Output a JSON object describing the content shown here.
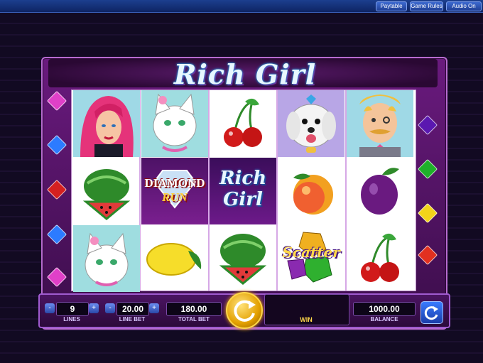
{
  "topbar": {
    "paytable": "Paytable",
    "game_rules": "Game Rules",
    "audio": "Audio On"
  },
  "logo": "Rich Girl",
  "reels": [
    [
      "woman",
      "watermelon",
      "white-cat"
    ],
    [
      "white-cat",
      "diamond-run",
      "lemon"
    ],
    [
      "cherries",
      "rich-girl",
      "watermelon"
    ],
    [
      "white-dog",
      "peach",
      "scatter-gems"
    ],
    [
      "butler",
      "plum",
      "cherries"
    ]
  ],
  "symbols": {
    "diamond_run_top": "DIAMOND",
    "diamond_run_bottom": "RUN",
    "rich_girl_top": "Rich",
    "rich_girl_bottom": "Girl",
    "scatter": "Scatter"
  },
  "controls": {
    "lines_value": "9",
    "lines_label": "LINES",
    "line_bet_value": "20.00",
    "line_bet_label": "LINE BET",
    "total_bet_value": "180.00",
    "total_bet_label": "TOTAL BET",
    "win_label": "WIN",
    "balance_value": "1000.00",
    "balance_label": "BALANCE",
    "minus": "-",
    "plus": "+"
  }
}
